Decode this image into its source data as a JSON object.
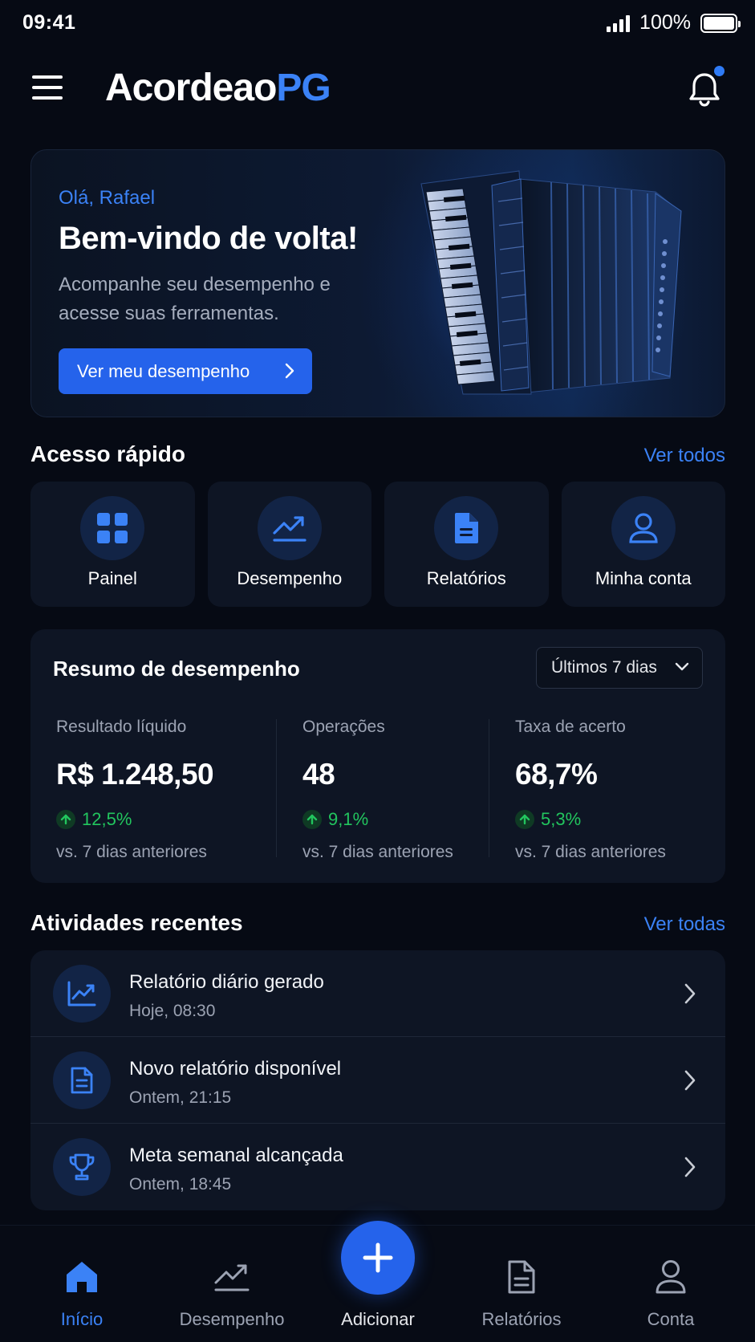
{
  "status_bar": {
    "time": "09:41",
    "battery": "100%"
  },
  "header": {
    "logo_primary": "Acordeao",
    "logo_accent": "PG",
    "has_notification": true
  },
  "hero": {
    "greeting": "Olá, Rafael",
    "title": "Bem-vindo de volta!",
    "subtitle": "Acompanhe seu desempenho e acesse suas ferramentas.",
    "button_label": "Ver meu desempenho",
    "image": "accordion-illustration"
  },
  "quick_access": {
    "title": "Acesso rápido",
    "link": "Ver todos",
    "items": [
      {
        "label": "Painel",
        "icon": "grid-icon"
      },
      {
        "label": "Desempenho",
        "icon": "trending-up-icon"
      },
      {
        "label": "Relatórios",
        "icon": "document-icon"
      },
      {
        "label": "Minha conta",
        "icon": "user-icon"
      }
    ]
  },
  "performance": {
    "title": "Resumo de desempenho",
    "period": "Últimos 7 dias",
    "metrics": [
      {
        "label": "Resultado líquido",
        "value": "R$ 1.248,50",
        "change": "12,5%",
        "compare": "vs. 7 dias anteriores"
      },
      {
        "label": "Operações",
        "value": "48",
        "change": "9,1%",
        "compare": "vs. 7 dias anteriores"
      },
      {
        "label": "Taxa de acerto",
        "value": "68,7%",
        "change": "5,3%",
        "compare": "vs. 7 dias anteriores"
      }
    ],
    "positive_color": "#22c55e"
  },
  "activities": {
    "title": "Atividades recentes",
    "link": "Ver todas",
    "items": [
      {
        "title": "Relatório diário gerado",
        "time": "Hoje, 08:30",
        "icon": "chart-icon"
      },
      {
        "title": "Novo relatório disponível",
        "time": "Ontem, 21:15",
        "icon": "document-icon"
      },
      {
        "title": "Meta semanal alcançada",
        "time": "Ontem, 18:45",
        "icon": "trophy-icon"
      }
    ]
  },
  "bottom_nav": {
    "items": [
      {
        "label": "Início",
        "icon": "home-icon",
        "active": true
      },
      {
        "label": "Desempenho",
        "icon": "trending-up-icon",
        "active": false
      },
      {
        "label": "Adicionar",
        "icon": "plus-icon",
        "active": false
      },
      {
        "label": "Relatórios",
        "icon": "document-icon",
        "active": false
      },
      {
        "label": "Conta",
        "icon": "user-icon",
        "active": false
      }
    ]
  },
  "colors": {
    "accent": "#3b82f6",
    "button": "#2563eb",
    "background": "#060a14",
    "card": "#0e1524"
  }
}
